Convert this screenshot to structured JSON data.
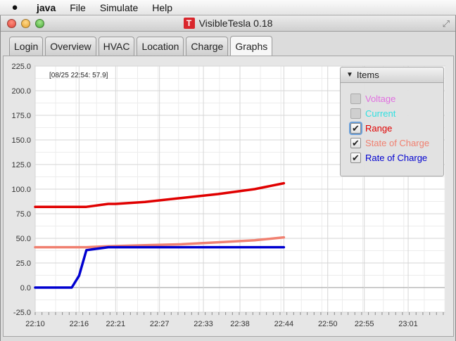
{
  "menubar": {
    "apple_icon": "apple-logo",
    "items": [
      "java",
      "File",
      "Simulate",
      "Help"
    ]
  },
  "window": {
    "title": "VisibleTesla 0.18",
    "logo": "T"
  },
  "tabs": [
    {
      "label": "Login",
      "active": false
    },
    {
      "label": "Overview",
      "active": false
    },
    {
      "label": "HVAC",
      "active": false
    },
    {
      "label": "Location",
      "active": false
    },
    {
      "label": "Charge",
      "active": false
    },
    {
      "label": "Graphs",
      "active": true
    }
  ],
  "timestamp": "[08/25 22:54: 57.9]",
  "items_panel": {
    "title": "Items",
    "items": [
      {
        "label": "Voltage",
        "checked": false,
        "color": "#e070e0",
        "enabled": false
      },
      {
        "label": "Current",
        "checked": false,
        "color": "#30e0e0",
        "enabled": false
      },
      {
        "label": "Range",
        "checked": true,
        "color": "#e00000",
        "enabled": true,
        "focused": true
      },
      {
        "label": "State of Charge",
        "checked": true,
        "color": "#f08070",
        "enabled": true
      },
      {
        "label": "Rate of Charge",
        "checked": true,
        "color": "#0000d0",
        "enabled": true
      }
    ]
  },
  "chart_data": {
    "type": "line",
    "xlabel": "",
    "ylabel": "",
    "ylim": [
      -25,
      225
    ],
    "yticks": [
      "225.0",
      "200.0",
      "175.0",
      "150.0",
      "125.0",
      "100.0",
      "75.0",
      "50.0",
      "25.0",
      "0.0",
      "-25.0"
    ],
    "ytick_values": [
      225,
      200,
      175,
      150,
      125,
      100,
      75,
      50,
      25,
      0,
      -25
    ],
    "xlim": [
      "22:10",
      "23:06"
    ],
    "xticks": [
      "22:10",
      "22:16",
      "22:21",
      "22:27",
      "22:33",
      "22:38",
      "22:44",
      "22:50",
      "22:55",
      "23:01"
    ],
    "grid": true,
    "series": [
      {
        "name": "Range",
        "color": "#e00000",
        "x": [
          "22:10",
          "22:14",
          "22:17",
          "22:18",
          "22:19",
          "22:20",
          "22:21",
          "22:25",
          "22:30",
          "22:35",
          "22:40",
          "22:44"
        ],
        "y": [
          82,
          82,
          82,
          83,
          84,
          85,
          85,
          87,
          91,
          95,
          100,
          106
        ]
      },
      {
        "name": "State of Charge",
        "color": "#f08070",
        "x": [
          "22:10",
          "22:17",
          "22:20",
          "22:25",
          "22:30",
          "22:35",
          "22:40",
          "22:44"
        ],
        "y": [
          41,
          41,
          42,
          43,
          44,
          46,
          48,
          51
        ]
      },
      {
        "name": "Rate of Charge",
        "color": "#0000d0",
        "x": [
          "22:10",
          "22:14",
          "22:15",
          "22:16",
          "22:17",
          "22:18",
          "22:19",
          "22:20",
          "22:44"
        ],
        "y": [
          0,
          0,
          0,
          12,
          38,
          39,
          40,
          41,
          41
        ]
      }
    ]
  }
}
